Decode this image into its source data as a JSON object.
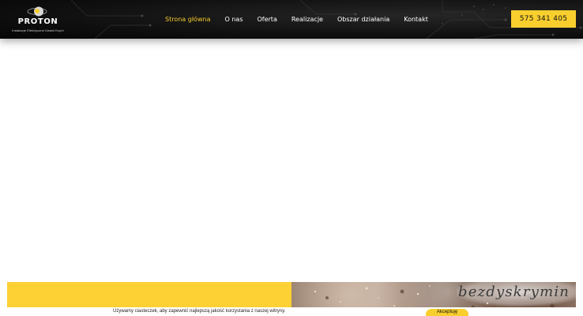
{
  "header": {
    "logo": {
      "name": "PROTON",
      "tagline": "Instalacje Elektryczne Dawid Krych"
    },
    "nav": [
      {
        "label": "Strona główna",
        "active": true
      },
      {
        "label": "O nas",
        "active": false
      },
      {
        "label": "Oferta",
        "active": false
      },
      {
        "label": "Realizacje",
        "active": false
      },
      {
        "label": "Obszar działania",
        "active": false
      },
      {
        "label": "Kontakt",
        "active": false
      }
    ],
    "phone": "575 341 405"
  },
  "watermark": "bezdyskrymin",
  "cookie": {
    "text": "Używamy ciasteczek, aby zapewnić najlepszą jakość korzystania z naszej witryny.",
    "accept": "Akceptuję"
  },
  "colors": {
    "accent": "#f9cf2e",
    "header_bg": "#111111",
    "active_nav": "#f4c92d"
  }
}
